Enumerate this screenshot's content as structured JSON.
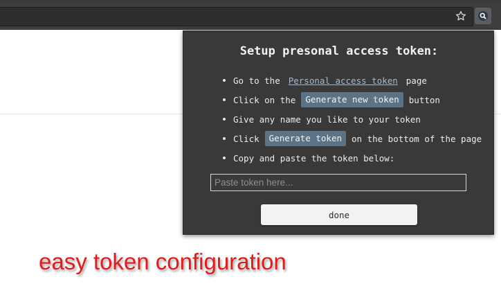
{
  "browser": {
    "bookmark_icon": "star-icon",
    "extension_icon": "magnifier-icon"
  },
  "popup": {
    "title": "Setup presonal access token:",
    "steps": [
      {
        "before": "Go to the",
        "link": "Personal access token",
        "after": "page"
      },
      {
        "before": "Click on the",
        "highlight": "Generate new token",
        "after": "button"
      },
      {
        "text": "Give any name you like to your token"
      },
      {
        "before": "Click",
        "highlight": "Generate token",
        "after": "on the bottom of the page"
      },
      {
        "text": "Copy and paste the token below:"
      }
    ],
    "token_input": {
      "placeholder": "Paste token here...",
      "value": ""
    },
    "done_label": "done"
  },
  "caption": "easy token configuration",
  "colors": {
    "popup_bg": "#393939",
    "highlight_bg": "#5b7385",
    "caption": "#e31b1b"
  }
}
